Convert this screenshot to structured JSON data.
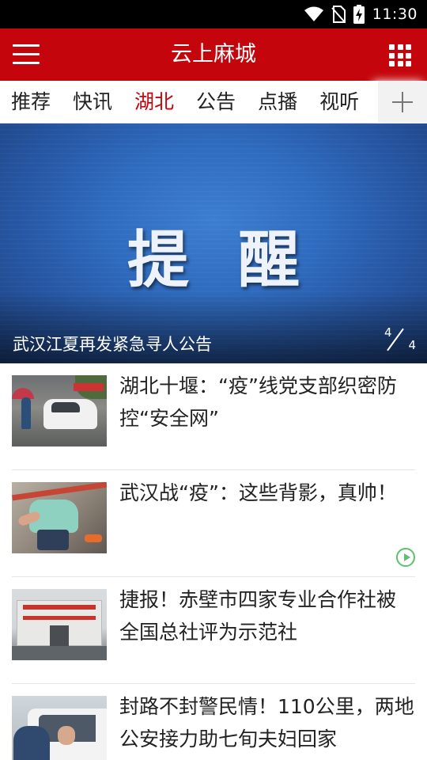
{
  "status_bar": {
    "time": "11:30",
    "icons": [
      "wifi-icon",
      "no-sim-icon",
      "battery-charging-icon"
    ]
  },
  "app_bar": {
    "title": "云上麻城",
    "left_icon": "menu-icon",
    "right_icon": "grid-apps-icon",
    "color": "#c4060c"
  },
  "tabs": {
    "items": [
      {
        "label": "推荐"
      },
      {
        "label": "快讯"
      },
      {
        "label": "湖北"
      },
      {
        "label": "公告"
      },
      {
        "label": "点播"
      },
      {
        "label": "视听"
      }
    ],
    "active": "湖北",
    "add_icon": "plus-icon"
  },
  "banner": {
    "image_text": "提醒",
    "caption": "武汉江夏再发紧急寻人公告",
    "current": "4",
    "total": "4"
  },
  "news": [
    {
      "title": "湖北十堰：“疫”线党支部织密防控“安全网”",
      "has_video": false
    },
    {
      "title": "武汉战“疫”：这些背影，真帅！",
      "has_video": true
    },
    {
      "title": "捷报！赤壁市四家专业合作社被全国总社评为示范社",
      "has_video": false
    },
    {
      "title": "封路不封警民情！110公里，两地公安接力助七旬夫妇回家",
      "has_video": false
    }
  ]
}
